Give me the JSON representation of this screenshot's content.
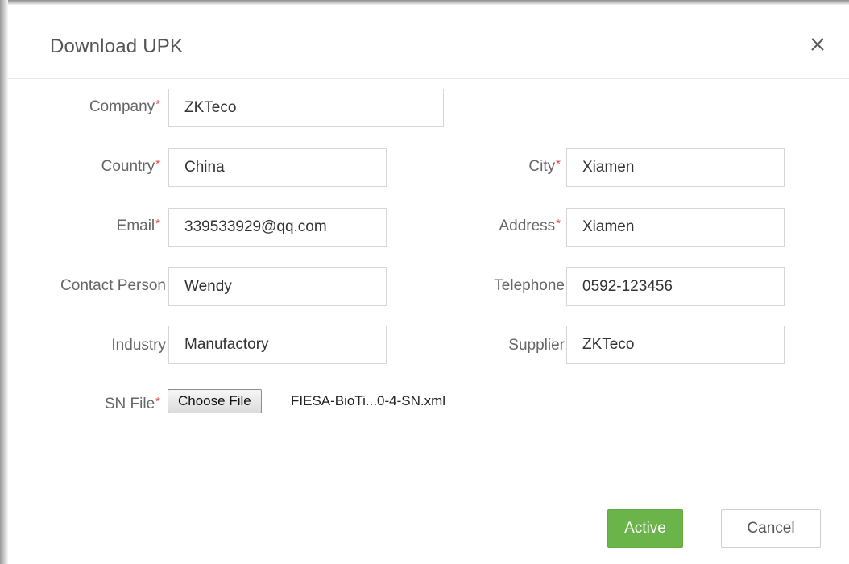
{
  "dialog": {
    "title": "Download UPK",
    "close_icon": "close-icon"
  },
  "form": {
    "required_mark": "*",
    "company": {
      "label": "Company",
      "value": "ZKTeco"
    },
    "country": {
      "label": "Country",
      "value": "China"
    },
    "city": {
      "label": "City",
      "value": "Xiamen"
    },
    "email": {
      "label": "Email",
      "value": "339533929@qq.com"
    },
    "address": {
      "label": "Address",
      "value": "Xiamen"
    },
    "contact_person": {
      "label": "Contact Person",
      "value": "Wendy"
    },
    "telephone": {
      "label": "Telephone",
      "value": "0592-123456"
    },
    "industry": {
      "label": "Industry",
      "value": "Manufactory"
    },
    "supplier": {
      "label": "Supplier",
      "value": "ZKTeco"
    },
    "sn_file": {
      "label": "SN File",
      "button_label": "Choose File",
      "file_name": "FIESA-BioTi...0-4-SN.xml"
    }
  },
  "actions": {
    "primary_label": "Active",
    "cancel_label": "Cancel"
  },
  "colors": {
    "primary": "#6ab44a",
    "required": "#e04848"
  }
}
